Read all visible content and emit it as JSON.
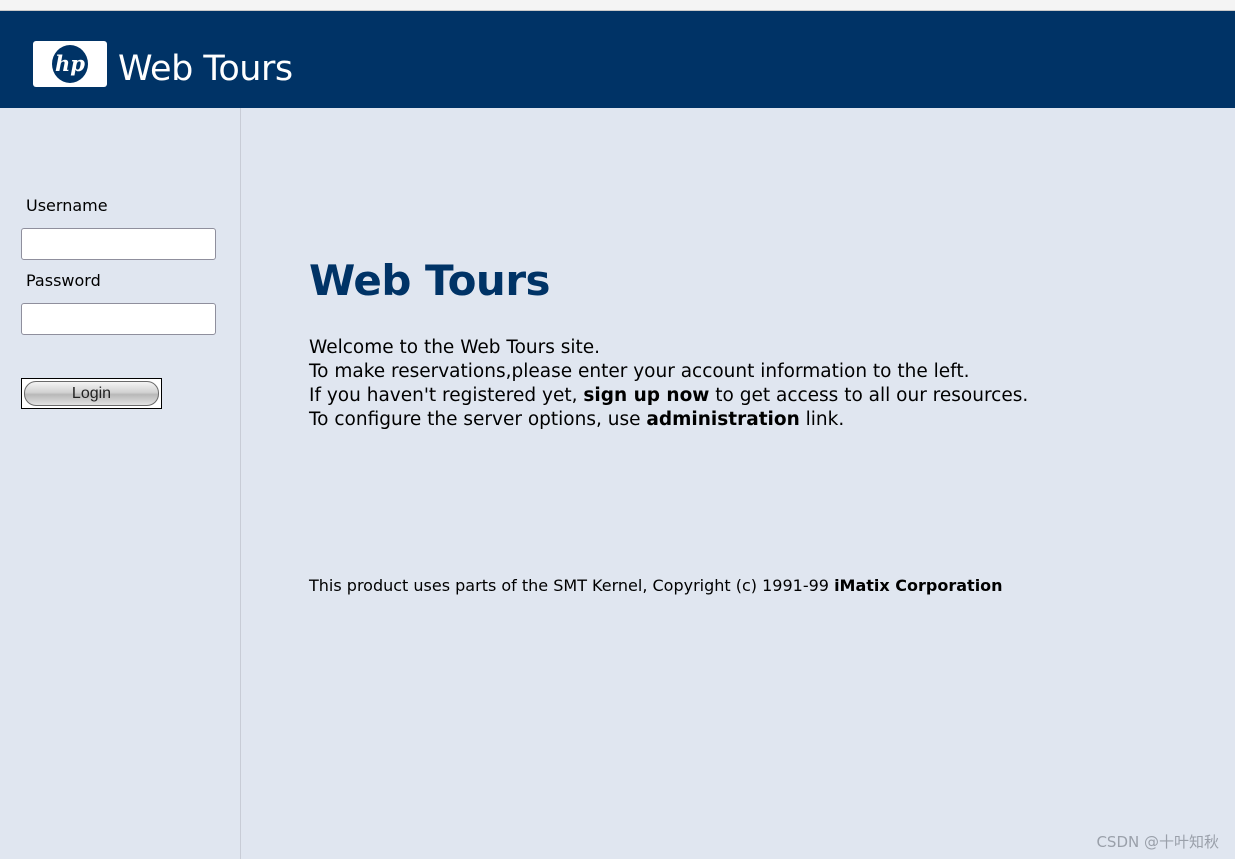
{
  "header": {
    "logo_text": "hp",
    "brand": "Web Tours"
  },
  "login": {
    "username_label": "Username",
    "username_value": "",
    "password_label": "Password",
    "password_value": "",
    "login_button": "Login"
  },
  "main": {
    "title": "Web Tours",
    "line1": "Welcome to the Web Tours site.",
    "line2": "To make reservations,please enter your account information to the left.",
    "line3_pre": "If you haven't registered yet, ",
    "line3_link": "sign up now",
    "line3_post": " to get access to all our resources.",
    "line4_pre": "To configure the server options, use ",
    "line4_link": "administration",
    "line4_post": " link.",
    "footer_pre": "This product uses parts of the SMT Kernel, Copyright (c) 1991-99 ",
    "footer_link": "iMatix Corporation"
  },
  "watermark": "CSDN @十叶知秋",
  "colors": {
    "header_bg": "#003366",
    "page_bg": "#e0e6f0",
    "title": "#003366"
  }
}
